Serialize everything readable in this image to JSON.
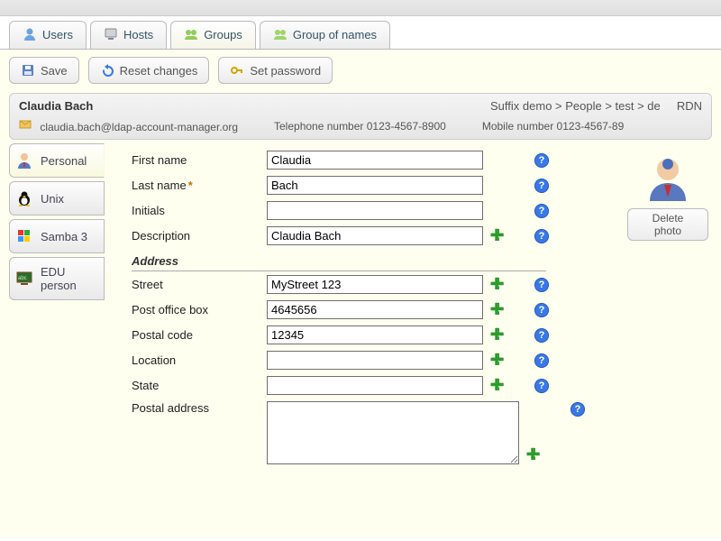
{
  "nav": {
    "tabs": [
      {
        "label": "Users"
      },
      {
        "label": "Hosts"
      },
      {
        "label": "Groups"
      },
      {
        "label": "Group of names"
      }
    ]
  },
  "actions": {
    "save": "Save",
    "reset": "Reset changes",
    "setpw": "Set password",
    "delete_photo": "Delete photo"
  },
  "header": {
    "name": "Claudia Bach",
    "suffix": "Suffix demo > People > test > de",
    "rdn": "RDN",
    "email": "claudia.bach@ldap-account-manager.org",
    "tel_label": "Telephone number",
    "tel_value": "0123-4567-8900",
    "mob_label": "Mobile number",
    "mob_value": "0123-4567-89"
  },
  "sidetabs": [
    {
      "label": "Personal"
    },
    {
      "label": "Unix"
    },
    {
      "label": "Samba 3"
    },
    {
      "label": "EDU person"
    }
  ],
  "fields": {
    "first_name": {
      "label": "First name",
      "value": "Claudia"
    },
    "last_name": {
      "label": "Last name",
      "value": "Bach"
    },
    "initials": {
      "label": "Initials",
      "value": ""
    },
    "description": {
      "label": "Description",
      "value": "Claudia Bach"
    },
    "section_address": "Address",
    "street": {
      "label": "Street",
      "value": "MyStreet 123"
    },
    "po_box": {
      "label": "Post office box",
      "value": "4645656"
    },
    "postal_code": {
      "label": "Postal code",
      "value": "12345"
    },
    "location": {
      "label": "Location",
      "value": ""
    },
    "state": {
      "label": "State",
      "value": ""
    },
    "postal_address": {
      "label": "Postal address",
      "value": ""
    }
  }
}
